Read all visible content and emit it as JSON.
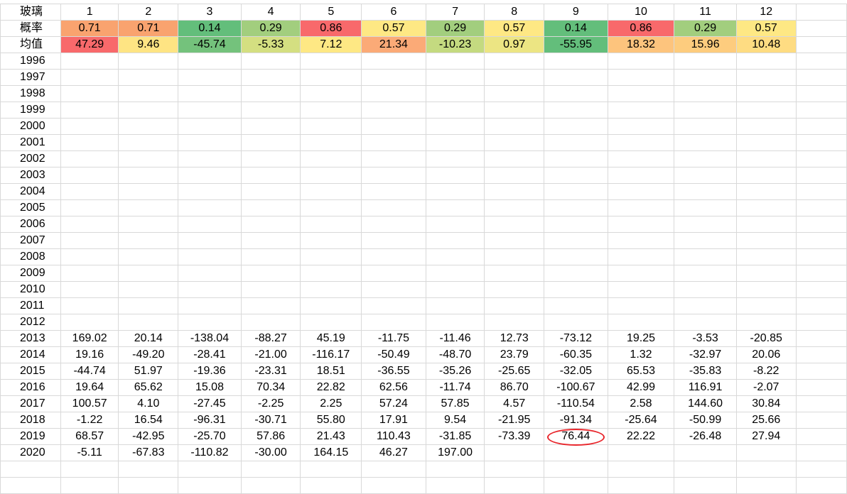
{
  "sheet": {
    "title_cell": "玻璃",
    "months": [
      "1",
      "2",
      "3",
      "4",
      "5",
      "6",
      "7",
      "8",
      "9",
      "10",
      "11",
      "12"
    ],
    "prob_label": "概率",
    "probabilities": [
      "0.71",
      "0.71",
      "0.14",
      "0.29",
      "0.86",
      "0.57",
      "0.29",
      "0.57",
      "0.14",
      "0.86",
      "0.29",
      "0.57"
    ],
    "prob_colors": [
      "#F9A36F",
      "#F9A36F",
      "#63BE7B",
      "#A2CE7E",
      "#F8696B",
      "#FEE884",
      "#A2CE7E",
      "#FEE884",
      "#63BE7B",
      "#F8696B",
      "#A2CE7E",
      "#FEE884"
    ],
    "mean_label": "均值",
    "means": [
      "47.29",
      "9.46",
      "-45.74",
      "-5.33",
      "7.12",
      "21.34",
      "-10.23",
      "0.97",
      "-55.95",
      "18.32",
      "15.96",
      "10.48"
    ],
    "mean_colors": [
      "#F8696B",
      "#FEE483",
      "#74C27C",
      "#D4DF81",
      "#FEE884",
      "#FBAA77",
      "#C4DA80",
      "#ECE583",
      "#63BE7B",
      "#FDC47D",
      "#FDCC7E",
      "#FEDC82"
    ],
    "rows": [
      {
        "year": "1996",
        "values": [
          "",
          "",
          "",
          "",
          "",
          "",
          "",
          "",
          "",
          "",
          "",
          ""
        ]
      },
      {
        "year": "1997",
        "values": [
          "",
          "",
          "",
          "",
          "",
          "",
          "",
          "",
          "",
          "",
          "",
          ""
        ]
      },
      {
        "year": "1998",
        "values": [
          "",
          "",
          "",
          "",
          "",
          "",
          "",
          "",
          "",
          "",
          "",
          ""
        ]
      },
      {
        "year": "1999",
        "values": [
          "",
          "",
          "",
          "",
          "",
          "",
          "",
          "",
          "",
          "",
          "",
          ""
        ]
      },
      {
        "year": "2000",
        "values": [
          "",
          "",
          "",
          "",
          "",
          "",
          "",
          "",
          "",
          "",
          "",
          ""
        ]
      },
      {
        "year": "2001",
        "values": [
          "",
          "",
          "",
          "",
          "",
          "",
          "",
          "",
          "",
          "",
          "",
          ""
        ]
      },
      {
        "year": "2002",
        "values": [
          "",
          "",
          "",
          "",
          "",
          "",
          "",
          "",
          "",
          "",
          "",
          ""
        ]
      },
      {
        "year": "2003",
        "values": [
          "",
          "",
          "",
          "",
          "",
          "",
          "",
          "",
          "",
          "",
          "",
          ""
        ]
      },
      {
        "year": "2004",
        "values": [
          "",
          "",
          "",
          "",
          "",
          "",
          "",
          "",
          "",
          "",
          "",
          ""
        ]
      },
      {
        "year": "2005",
        "values": [
          "",
          "",
          "",
          "",
          "",
          "",
          "",
          "",
          "",
          "",
          "",
          ""
        ]
      },
      {
        "year": "2006",
        "values": [
          "",
          "",
          "",
          "",
          "",
          "",
          "",
          "",
          "",
          "",
          "",
          ""
        ]
      },
      {
        "year": "2007",
        "values": [
          "",
          "",
          "",
          "",
          "",
          "",
          "",
          "",
          "",
          "",
          "",
          ""
        ]
      },
      {
        "year": "2008",
        "values": [
          "",
          "",
          "",
          "",
          "",
          "",
          "",
          "",
          "",
          "",
          "",
          ""
        ]
      },
      {
        "year": "2009",
        "values": [
          "",
          "",
          "",
          "",
          "",
          "",
          "",
          "",
          "",
          "",
          "",
          ""
        ]
      },
      {
        "year": "2010",
        "values": [
          "",
          "",
          "",
          "",
          "",
          "",
          "",
          "",
          "",
          "",
          "",
          ""
        ]
      },
      {
        "year": "2011",
        "values": [
          "",
          "",
          "",
          "",
          "",
          "",
          "",
          "",
          "",
          "",
          "",
          ""
        ]
      },
      {
        "year": "2012",
        "values": [
          "",
          "",
          "",
          "",
          "",
          "",
          "",
          "",
          "",
          "",
          "",
          ""
        ]
      },
      {
        "year": "2013",
        "values": [
          "169.02",
          "20.14",
          "-138.04",
          "-88.27",
          "45.19",
          "-11.75",
          "-11.46",
          "12.73",
          "-73.12",
          "19.25",
          "-3.53",
          "-20.85"
        ]
      },
      {
        "year": "2014",
        "values": [
          "19.16",
          "-49.20",
          "-28.41",
          "-21.00",
          "-116.17",
          "-50.49",
          "-48.70",
          "23.79",
          "-60.35",
          "1.32",
          "-32.97",
          "20.06"
        ]
      },
      {
        "year": "2015",
        "values": [
          "-44.74",
          "51.97",
          "-19.36",
          "-23.31",
          "18.51",
          "-36.55",
          "-35.26",
          "-25.65",
          "-32.05",
          "65.53",
          "-35.83",
          "-8.22"
        ]
      },
      {
        "year": "2016",
        "values": [
          "19.64",
          "65.62",
          "15.08",
          "70.34",
          "22.82",
          "62.56",
          "-11.74",
          "86.70",
          "-100.67",
          "42.99",
          "116.91",
          "-2.07"
        ]
      },
      {
        "year": "2017",
        "values": [
          "100.57",
          "4.10",
          "-27.45",
          "-2.25",
          "2.25",
          "57.24",
          "57.85",
          "4.57",
          "-110.54",
          "2.58",
          "144.60",
          "30.84"
        ]
      },
      {
        "year": "2018",
        "values": [
          "-1.22",
          "16.54",
          "-96.31",
          "-30.71",
          "55.80",
          "17.91",
          "9.54",
          "-21.95",
          "-91.34",
          "-25.64",
          "-50.99",
          "25.66"
        ]
      },
      {
        "year": "2019",
        "values": [
          "68.57",
          "-42.95",
          "-25.70",
          "57.86",
          "21.43",
          "110.43",
          "-31.85",
          "-73.39",
          "76.44",
          "22.22",
          "-26.48",
          "27.94"
        ]
      },
      {
        "year": "2020",
        "values": [
          "-5.11",
          "-67.83",
          "-110.82",
          "-30.00",
          "164.15",
          "46.27",
          "197.00",
          "",
          "",
          "",
          "",
          ""
        ]
      }
    ],
    "highlight": {
      "year": "2019",
      "month_index": 8,
      "color": "#E8262C"
    }
  }
}
